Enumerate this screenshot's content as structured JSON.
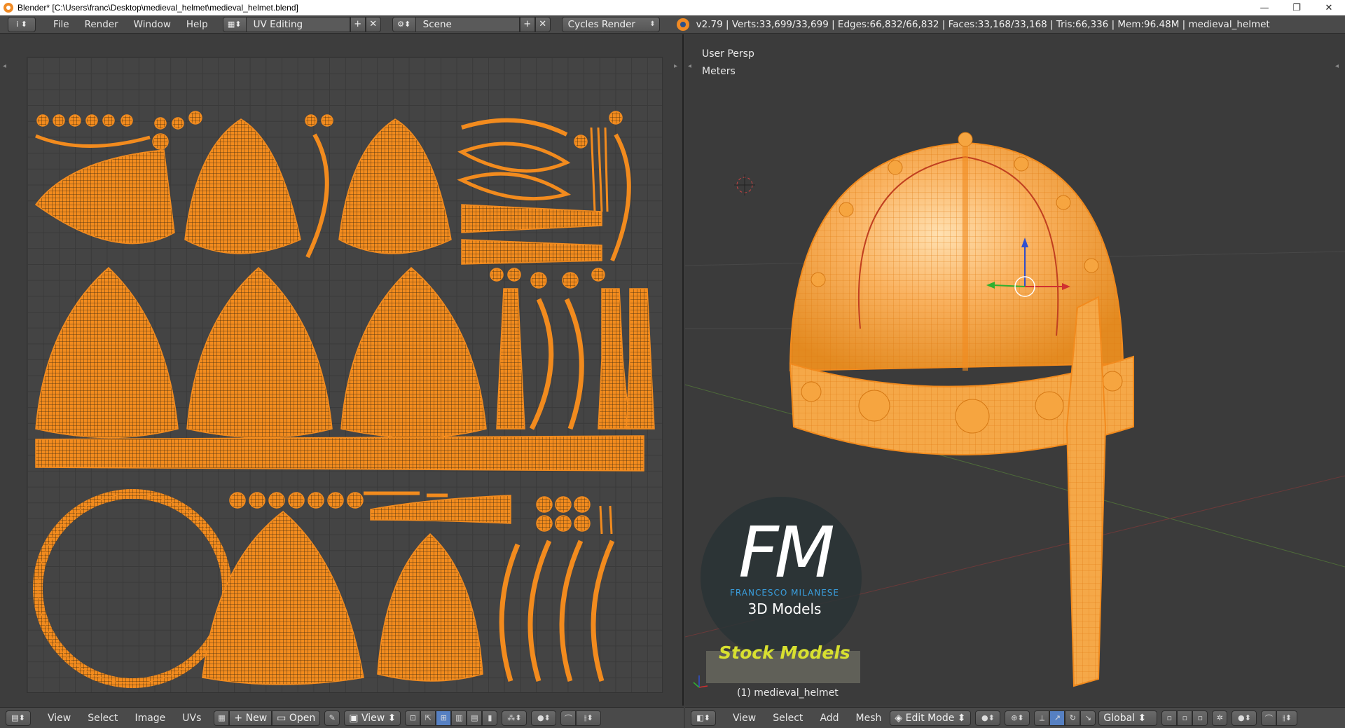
{
  "titlebar": {
    "title": "Blender* [C:\\Users\\franc\\Desktop\\medieval_helmet\\medieval_helmet.blend]",
    "minimize": "—",
    "restore": "❐",
    "close": "✕"
  },
  "infobar": {
    "editor_icon": "i ⬍",
    "menus": [
      "File",
      "Render",
      "Window",
      "Help"
    ],
    "screen_layout": "UV Editing",
    "scene": "Scene",
    "render_engine": "Cycles Render",
    "add_symbol": "+",
    "remove_symbol": "✕",
    "stats": "v2.79 | Verts:33,699/33,699 | Edges:66,832/66,832 | Faces:33,168/33,168 | Tris:66,336 | Mem:96.48M | medieval_helmet"
  },
  "viewport": {
    "view_name": "User Persp",
    "units": "Meters",
    "object_label": "(1) medieval_helmet",
    "logo_main": "FM",
    "logo_sub": "FRANCESCO MILANESE",
    "logo_tag": "3D Models",
    "stock_label": "Stock Models"
  },
  "uv_footer": {
    "menus": [
      "View",
      "Select",
      "Image",
      "UVs"
    ],
    "new_label": "New",
    "open_label": "Open",
    "view_label": "View"
  },
  "vp_footer": {
    "menus": [
      "View",
      "Select",
      "Add",
      "Mesh"
    ],
    "mode": "Edit Mode",
    "orientation": "Global"
  },
  "colors": {
    "accent_orange": "#f28b1e",
    "header_bg": "#4a4a4a",
    "panel_bg": "#3d3d3d"
  }
}
